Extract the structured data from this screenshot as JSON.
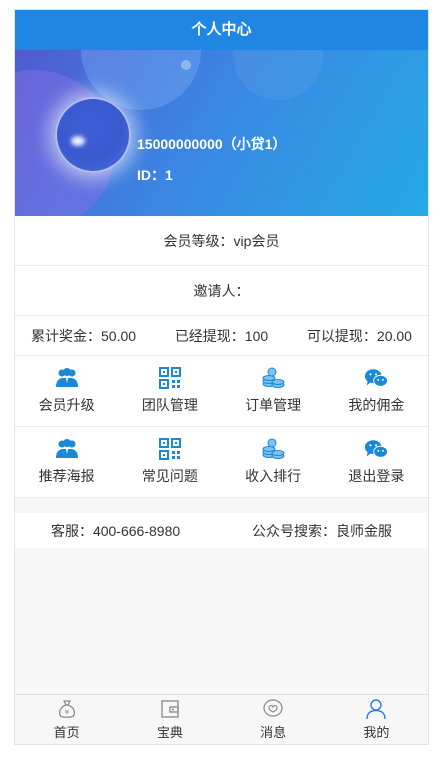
{
  "header": {
    "title": "个人中心"
  },
  "profile": {
    "name": "15000000000（小贷1）",
    "id": "ID：1"
  },
  "member_level": "会员等级：vip会员",
  "inviter": "邀请人：",
  "stats": {
    "total_bonus": "累计奖金：50.00",
    "withdrawn": "已经提现：100",
    "available": "可以提现：20.00"
  },
  "grid": [
    {
      "label": "会员升级",
      "icon": "users-icon"
    },
    {
      "label": "团队管理",
      "icon": "qrcode-icon"
    },
    {
      "label": "订单管理",
      "icon": "coins-icon"
    },
    {
      "label": "我的佣金",
      "icon": "wechat-icon"
    },
    {
      "label": "推荐海报",
      "icon": "users-icon"
    },
    {
      "label": "常见问题",
      "icon": "qrcode-icon"
    },
    {
      "label": "收入排行",
      "icon": "coins-icon"
    },
    {
      "label": "退出登录",
      "icon": "wechat-icon"
    }
  ],
  "contact": {
    "service": "客服：400-666-8980",
    "official": "公众号搜索：良师金服"
  },
  "tabbar": [
    {
      "label": "首页",
      "icon": "money-bag-icon"
    },
    {
      "label": "宝典",
      "icon": "book-icon"
    },
    {
      "label": "消息",
      "icon": "message-icon"
    },
    {
      "label": "我的",
      "icon": "user-icon",
      "active": true
    }
  ],
  "colors": {
    "accent": "#1f86e3",
    "icon_blue": "#1a88d8",
    "active_tab": "#2f7be0"
  }
}
